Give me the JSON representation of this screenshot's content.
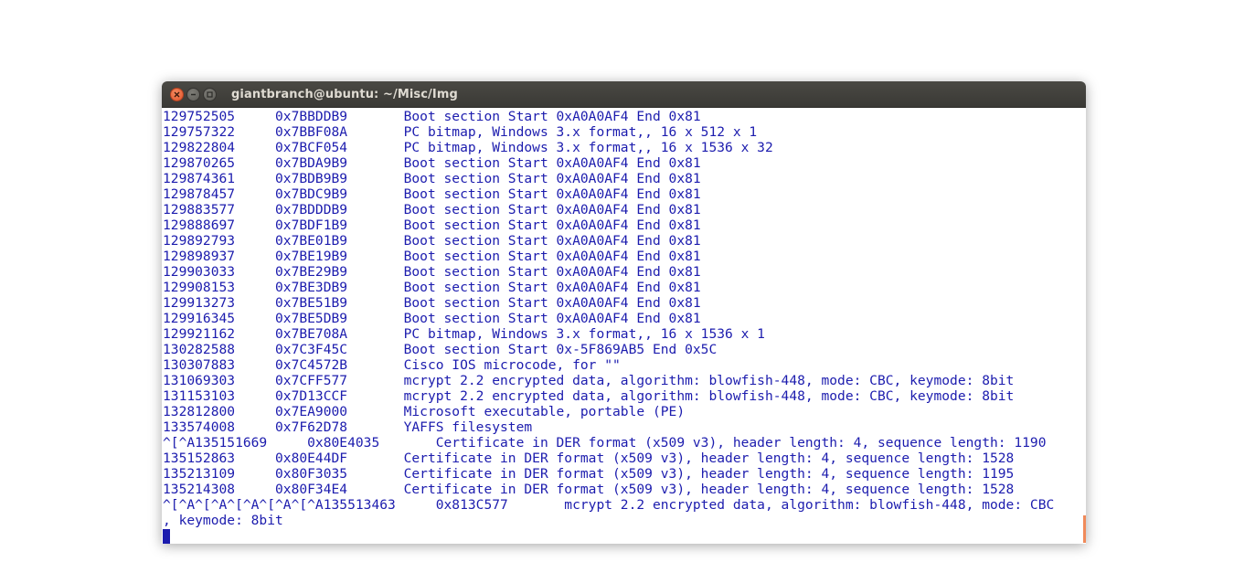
{
  "window": {
    "title": "giantbranch@ubuntu: ~/Misc/Img",
    "controls": {
      "close_icon": "close-icon",
      "minimize_icon": "minimize-icon",
      "maximize_icon": "maximize-icon"
    }
  },
  "colors": {
    "terminal_text": "#1c1cae",
    "titlebar": "#3c3b37",
    "title_text": "#dfdbd2",
    "close_button": "#e95420"
  },
  "terminal": {
    "lines": [
      "129752505     0x7BBDDB9       Boot section Start 0xA0A0AF4 End 0x81",
      "129757322     0x7BBF08A       PC bitmap, Windows 3.x format,, 16 x 512 x 1",
      "129822804     0x7BCF054       PC bitmap, Windows 3.x format,, 16 x 1536 x 32",
      "129870265     0x7BDA9B9       Boot section Start 0xA0A0AF4 End 0x81",
      "129874361     0x7BDB9B9       Boot section Start 0xA0A0AF4 End 0x81",
      "129878457     0x7BDC9B9       Boot section Start 0xA0A0AF4 End 0x81",
      "129883577     0x7BDDDB9       Boot section Start 0xA0A0AF4 End 0x81",
      "129888697     0x7BDF1B9       Boot section Start 0xA0A0AF4 End 0x81",
      "129892793     0x7BE01B9       Boot section Start 0xA0A0AF4 End 0x81",
      "129898937     0x7BE19B9       Boot section Start 0xA0A0AF4 End 0x81",
      "129903033     0x7BE29B9       Boot section Start 0xA0A0AF4 End 0x81",
      "129908153     0x7BE3DB9       Boot section Start 0xA0A0AF4 End 0x81",
      "129913273     0x7BE51B9       Boot section Start 0xA0A0AF4 End 0x81",
      "129916345     0x7BE5DB9       Boot section Start 0xA0A0AF4 End 0x81",
      "129921162     0x7BE708A       PC bitmap, Windows 3.x format,, 16 x 1536 x 1",
      "130282588     0x7C3F45C       Boot section Start 0x-5F869AB5 End 0x5C",
      "130307883     0x7C4572B       Cisco IOS microcode, for \"\"",
      "131069303     0x7CFF577       mcrypt 2.2 encrypted data, algorithm: blowfish-448, mode: CBC, keymode: 8bit",
      "131153103     0x7D13CCF       mcrypt 2.2 encrypted data, algorithm: blowfish-448, mode: CBC, keymode: 8bit",
      "132812800     0x7EA9000       Microsoft executable, portable (PE)",
      "133574008     0x7F62D78       YAFFS filesystem",
      "^[^A135151669     0x80E4035       Certificate in DER format (x509 v3), header length: 4, sequence length: 1190",
      "135152863     0x80E44DF       Certificate in DER format (x509 v3), header length: 4, sequence length: 1528",
      "135213109     0x80F3035       Certificate in DER format (x509 v3), header length: 4, sequence length: 1195",
      "135214308     0x80F34E4       Certificate in DER format (x509 v3), header length: 4, sequence length: 1528",
      "^[^A^[^A^[^A^[^A^[^A135513463     0x813C577       mcrypt 2.2 encrypted data, algorithm: blowfish-448, mode: CBC",
      ", keymode: 8bit"
    ]
  }
}
